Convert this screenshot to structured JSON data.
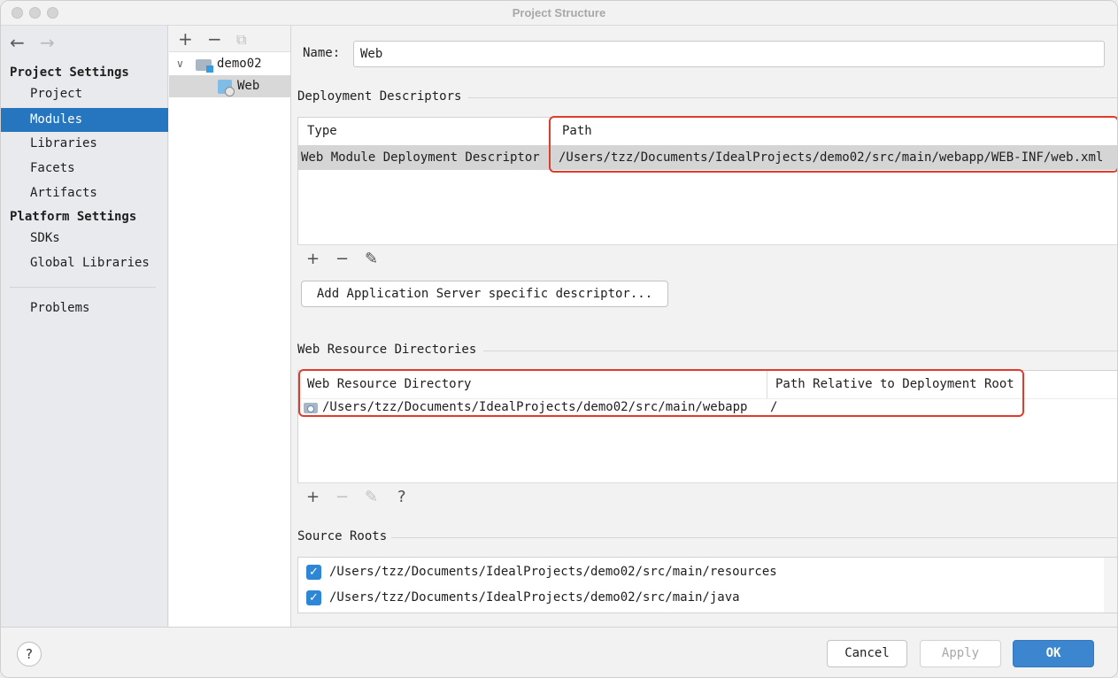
{
  "window": {
    "title": "Project Structure"
  },
  "sidebar": {
    "project_settings_header": "Project Settings",
    "project_settings_items": [
      "Project",
      "Modules",
      "Libraries",
      "Facets",
      "Artifacts"
    ],
    "platform_settings_header": "Platform Settings",
    "platform_settings_items": [
      "SDKs",
      "Global Libraries"
    ],
    "other_items": [
      "Problems"
    ],
    "selected": "Modules"
  },
  "tree": {
    "module": "demo02",
    "facet": "Web"
  },
  "name_field": {
    "label": "Name:",
    "value": "Web"
  },
  "deployment": {
    "title": "Deployment Descriptors",
    "columns": [
      "Type",
      "Path"
    ],
    "rows": [
      {
        "type": "Web Module Deployment Descriptor",
        "path": "/Users/tzz/Documents/IdealProjects/demo02/src/main/webapp/WEB-INF/web.xml"
      }
    ],
    "add_server_button": "Add Application Server specific descriptor..."
  },
  "web_resources": {
    "title": "Web Resource Directories",
    "columns": [
      "Web Resource Directory",
      "Path Relative to Deployment Root"
    ],
    "rows": [
      {
        "directory": "/Users/tzz/Documents/IdealProjects/demo02/src/main/webapp",
        "relative": "/"
      }
    ],
    "help_icon": "?"
  },
  "source_roots": {
    "title": "Source Roots",
    "items": [
      {
        "path": "/Users/tzz/Documents/IdealProjects/demo02/src/main/resources",
        "checked": true
      },
      {
        "path": "/Users/tzz/Documents/IdealProjects/demo02/src/main/java",
        "checked": true
      }
    ]
  },
  "footer": {
    "help": "?",
    "cancel": "Cancel",
    "apply": "Apply",
    "ok": "OK"
  },
  "colors": {
    "selection": "#2675bf",
    "highlight": "#e03c2c",
    "checkbox": "#2e86d7",
    "primary_button": "#3c86cf"
  }
}
